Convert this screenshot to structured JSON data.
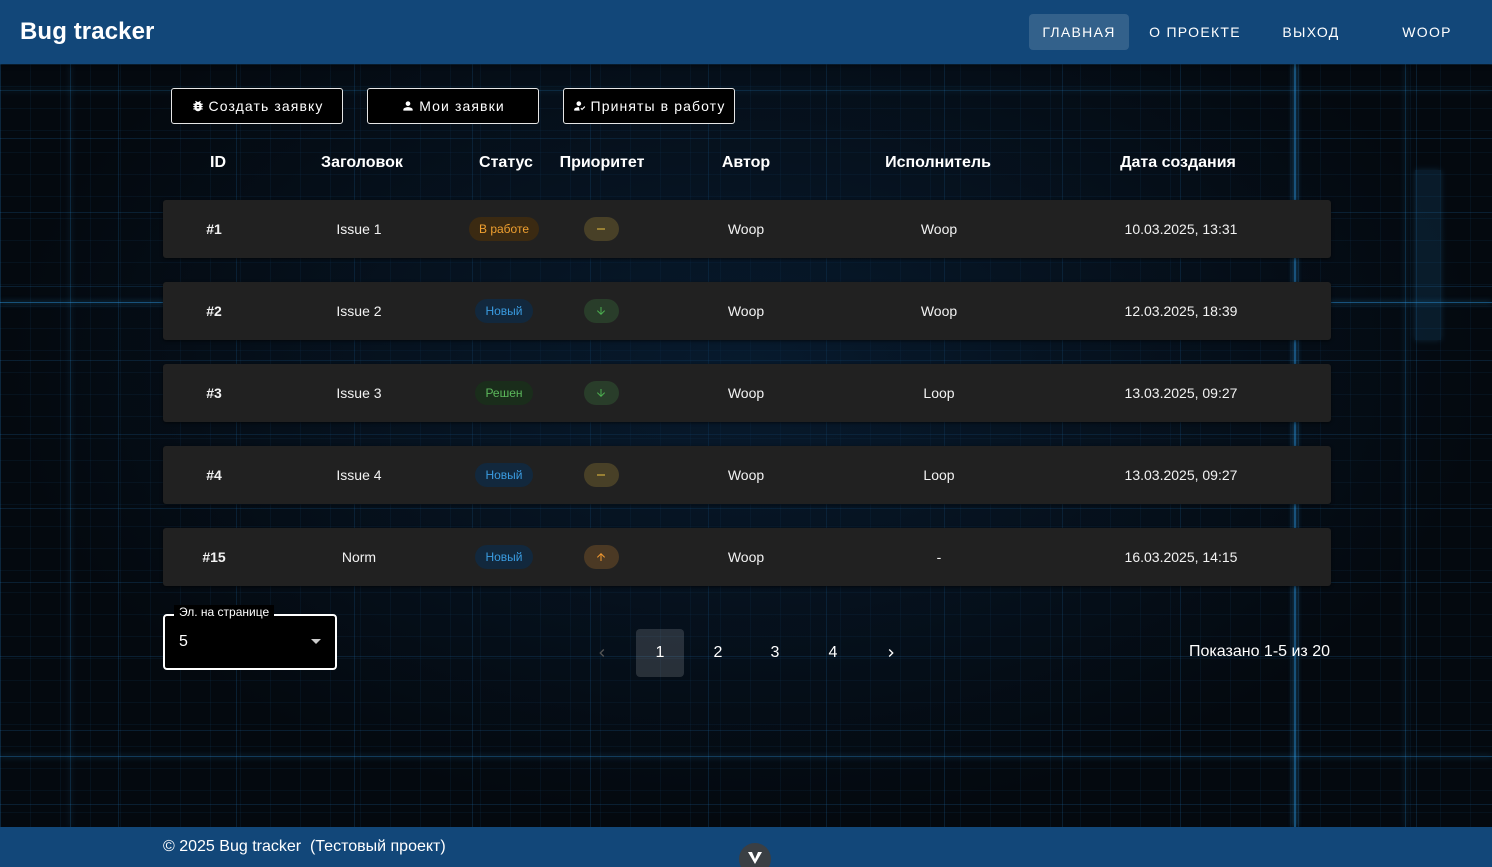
{
  "header": {
    "brand": "Bug tracker",
    "nav": [
      {
        "label": "Главная",
        "active": true
      },
      {
        "label": "О проекте",
        "active": false
      },
      {
        "label": "Выход",
        "active": false
      },
      {
        "label": "Woop",
        "active": false
      }
    ]
  },
  "actions": {
    "create": {
      "label": "Создать заявку",
      "icon": "bug-icon"
    },
    "mine": {
      "label": "Мои заявки",
      "icon": "person-icon"
    },
    "accepted": {
      "label": "Приняты в работу",
      "icon": "person-check-icon"
    }
  },
  "table": {
    "headers": [
      "ID",
      "Заголовок",
      "Статус",
      "Приоритет",
      "Автор",
      "Исполнитель",
      "Дата создания"
    ],
    "rows": [
      {
        "id": "#1",
        "title": "Issue 1",
        "status": "В работе",
        "status_kind": "progress",
        "priority": "medium",
        "author": "Woop",
        "assignee": "Woop",
        "created": "10.03.2025, 13:31"
      },
      {
        "id": "#2",
        "title": "Issue 2",
        "status": "Новый",
        "status_kind": "new",
        "priority": "low",
        "author": "Woop",
        "assignee": "Woop",
        "created": "12.03.2025, 18:39"
      },
      {
        "id": "#3",
        "title": "Issue 3",
        "status": "Решен",
        "status_kind": "resolved",
        "priority": "low",
        "author": "Woop",
        "assignee": "Loop",
        "created": "13.03.2025, 09:27"
      },
      {
        "id": "#4",
        "title": "Issue 4",
        "status": "Новый",
        "status_kind": "new",
        "priority": "medium",
        "author": "Woop",
        "assignee": "Loop",
        "created": "13.03.2025, 09:27"
      },
      {
        "id": "#15",
        "title": "Norm",
        "status": "Новый",
        "status_kind": "new",
        "priority": "high",
        "author": "Woop",
        "assignee": "-",
        "created": "16.03.2025, 14:15"
      }
    ]
  },
  "pagination": {
    "per_page_label": "Эл. на странице",
    "per_page_value": "5",
    "pages": [
      "1",
      "2",
      "3",
      "4"
    ],
    "current_page": "1",
    "shown_text": "Показано 1-5 из 20"
  },
  "footer": {
    "text": "© 2025 Bug tracker  (Тестовый проект)"
  },
  "colors": {
    "appbar": "#124779",
    "row": "#212121",
    "status_progress_bg": "#3b2a12",
    "status_progress_fg": "#f0a030",
    "status_new_bg": "#12283d",
    "status_new_fg": "#3a9be0",
    "status_resolved_bg": "#1a2d1b",
    "status_resolved_fg": "#5cb85c",
    "priority_medium": "#e8c040",
    "priority_low": "#4cb050",
    "priority_high": "#f39a30"
  }
}
